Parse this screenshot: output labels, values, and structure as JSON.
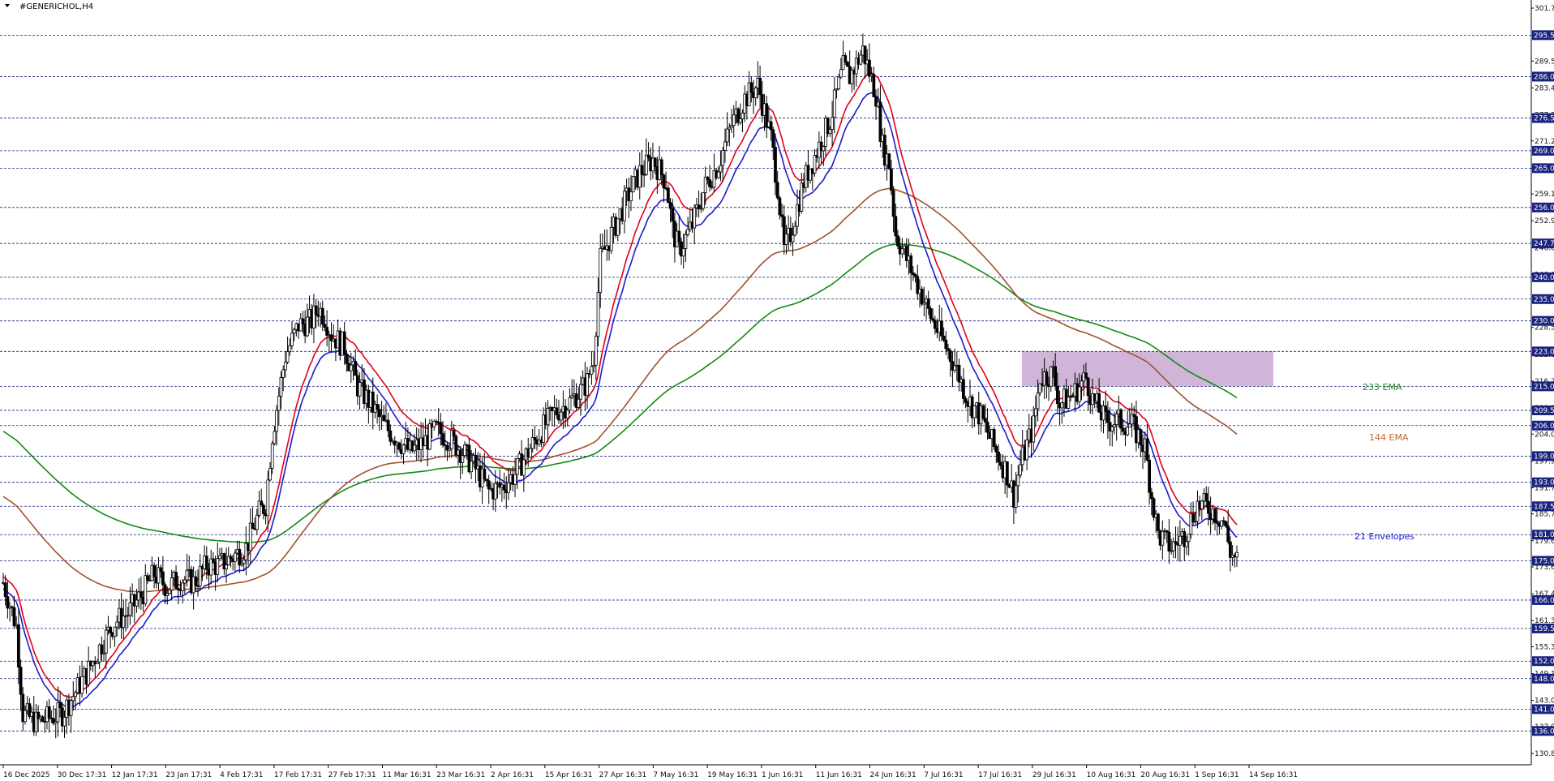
{
  "window": {
    "title": "#GENERICHOL,H4"
  },
  "colors": {
    "background": "#ffffff",
    "candle": "#000000",
    "level_line": "#1a237e",
    "level_badge": "#1a237e",
    "env_upper": "#e0001a",
    "env_lower": "#1c1ccc",
    "ema144": "#a0522d",
    "ema233": "#138a13",
    "zone_fill": "#c8a8d2"
  },
  "chart_data": {
    "type": "candlestick",
    "title": "#GENERICHOL,H4",
    "ylim": [
      130.85,
      301.7
    ],
    "grid": false,
    "x_tick_labels": [
      "16 Dec 2025",
      "30 Dec 17:31",
      "12 Jan 17:31",
      "23 Jan 17:31",
      "4 Feb 17:31",
      "17 Feb 17:31",
      "27 Feb 17:31",
      "11 Mar 16:31",
      "23 Mar 16:31",
      "2 Apr 16:31",
      "15 Apr 16:31",
      "27 Apr 16:31",
      "7 May 16:31",
      "19 May 16:31",
      "1 Jun 16:31",
      "11 Jun 16:31",
      "24 Jun 16:31",
      "7 Jul 16:31",
      "17 Jul 16:31",
      "29 Jul 16:31",
      "10 Aug 16:31",
      "20 Aug 16:31",
      "1 Sep 16:31",
      "14 Sep 16:31"
    ],
    "y_tick_labels": [
      "301.70",
      "289.55",
      "283.40",
      "277.25",
      "271.25",
      "265.00",
      "259.10",
      "252.95",
      "246.80",
      "240.65",
      "234.50",
      "228.50",
      "222.35",
      "216.20",
      "210.05",
      "204.05",
      "197.90",
      "191.75",
      "185.75",
      "179.60",
      "173.60",
      "167.45",
      "161.30",
      "155.30",
      "149.15",
      "143.00",
      "137.00",
      "130.85"
    ],
    "levels": [
      "295.50",
      "286.00",
      "276.50",
      "269.00",
      "265.00",
      "256.00",
      "247.75",
      "240.00",
      "235.00",
      "230.00",
      "223.00",
      "215.00",
      "209.50",
      "206.00",
      "199.00",
      "193.00",
      "187.50",
      "181.00",
      "175.00",
      "166.00",
      "159.50",
      "152.00",
      "148.00",
      "141.00",
      "136.00"
    ],
    "zone": {
      "from": 215.0,
      "to": 223.0
    },
    "annotations": {
      "ema233": "233 EMA",
      "ema144": "144 EMA",
      "envelopes": "21 Envelopes"
    },
    "price_path": [
      [
        0,
        170
      ],
      [
        2,
        160
      ],
      [
        3,
        140
      ],
      [
        5,
        138
      ],
      [
        7,
        139
      ],
      [
        9,
        140
      ],
      [
        11,
        145
      ],
      [
        13,
        150
      ],
      [
        15,
        156
      ],
      [
        17,
        161
      ],
      [
        19,
        163
      ],
      [
        21,
        167
      ],
      [
        23,
        172
      ],
      [
        25,
        169
      ],
      [
        27,
        171
      ],
      [
        29,
        170
      ],
      [
        31,
        174
      ],
      [
        33,
        174
      ],
      [
        35,
        176
      ],
      [
        37,
        178
      ],
      [
        39,
        186
      ],
      [
        40,
        188
      ],
      [
        41,
        204
      ],
      [
        42,
        213
      ],
      [
        43,
        222
      ],
      [
        45,
        229
      ],
      [
        47,
        230
      ],
      [
        48,
        233
      ],
      [
        49,
        231
      ],
      [
        50,
        227
      ],
      [
        52,
        224
      ],
      [
        54,
        215
      ],
      [
        56,
        211
      ],
      [
        58,
        206
      ],
      [
        60,
        203
      ],
      [
        62,
        200
      ],
      [
        64,
        202
      ],
      [
        66,
        205
      ],
      [
        68,
        203
      ],
      [
        70,
        200
      ],
      [
        72,
        196
      ],
      [
        74,
        191
      ],
      [
        76,
        192
      ],
      [
        78,
        195
      ],
      [
        80,
        200
      ],
      [
        82,
        205
      ],
      [
        84,
        209
      ],
      [
        86,
        211
      ],
      [
        88,
        214
      ],
      [
        89,
        216
      ],
      [
        90,
        222
      ],
      [
        91,
        244
      ],
      [
        93,
        251
      ],
      [
        95,
        258
      ],
      [
        97,
        264
      ],
      [
        99,
        267
      ],
      [
        101,
        262
      ],
      [
        102,
        251
      ],
      [
        103,
        246
      ],
      [
        105,
        252
      ],
      [
        107,
        261
      ],
      [
        109,
        266
      ],
      [
        111,
        275
      ],
      [
        113,
        281
      ],
      [
        115,
        284
      ],
      [
        117,
        272
      ],
      [
        118,
        261
      ],
      [
        119,
        246
      ],
      [
        120,
        250
      ],
      [
        121,
        256
      ],
      [
        122,
        262
      ],
      [
        124,
        269
      ],
      [
        126,
        276
      ],
      [
        128,
        288
      ],
      [
        129,
        286
      ],
      [
        131,
        292
      ],
      [
        133,
        282
      ],
      [
        134,
        270
      ],
      [
        135,
        266
      ],
      [
        136,
        250
      ],
      [
        138,
        243
      ],
      [
        140,
        236
      ],
      [
        141,
        232
      ],
      [
        143,
        226
      ],
      [
        145,
        220
      ],
      [
        147,
        212
      ],
      [
        149,
        208
      ],
      [
        151,
        201
      ],
      [
        153,
        195
      ],
      [
        154,
        190
      ],
      [
        155,
        197
      ],
      [
        157,
        206
      ],
      [
        158,
        217
      ],
      [
        160,
        218
      ],
      [
        161,
        211
      ],
      [
        163,
        213
      ],
      [
        165,
        217
      ],
      [
        166,
        212
      ],
      [
        168,
        207
      ],
      [
        170,
        207
      ],
      [
        172,
        206
      ],
      [
        174,
        201
      ],
      [
        175,
        190
      ],
      [
        176,
        181
      ],
      [
        178,
        178
      ],
      [
        180,
        181
      ],
      [
        182,
        188
      ],
      [
        184,
        187
      ],
      [
        186,
        184
      ],
      [
        187,
        177
      ],
      [
        188,
        175
      ]
    ]
  }
}
